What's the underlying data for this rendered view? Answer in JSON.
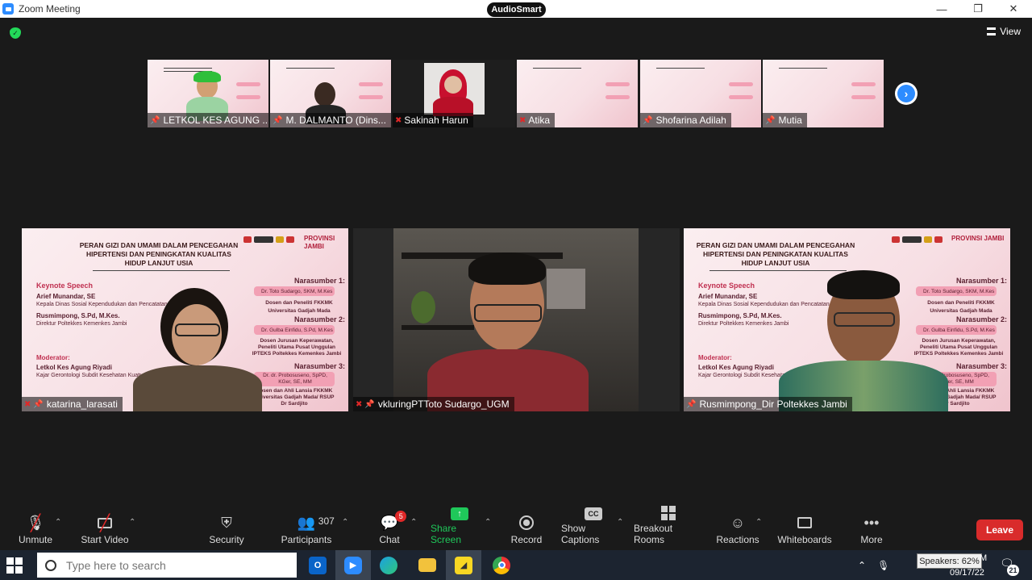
{
  "window": {
    "title": "Zoom Meeting",
    "badge": "AudioSmart",
    "minimize": "—",
    "restore": "❐",
    "close": "✕"
  },
  "header": {
    "view_label": "View"
  },
  "slide": {
    "title_line1": "PERAN GIZI DAN UMAMI DALAM PENCEGAHAN",
    "title_line2": "HIPERTENSI DAN PENINGKATAN KUALITAS",
    "title_line3": "HIDUP LANJUT USIA",
    "keynote": "Keynote Speech",
    "k1_name": "Arief Munandar, SE",
    "k1_role": "Kepala Dinas Sosial Kependudukan dan Pencatatan Sipil",
    "k2_name": "Rusmimpong, S.Pd, M.Kes.",
    "k2_role": "Direktur Poltekkes Kemenkes Jambi",
    "moderator": "Moderator:",
    "m_name": "Letkol Kes Agung Riyadi",
    "m_role": "Kajar Gerontologi Subdit Kesehatan Kuatman RI",
    "n1": "Narasumber 1:",
    "n1_name": "Dr. Toto Sudargo, SKM, M.Kes",
    "n1_role": "Dosen dan Peneliti FKKMK Universitas Gadjah Mada",
    "n2": "Narasumber 2:",
    "n2_name": "Dr. Gulba Einfidu, S.Pd, M.Kes",
    "n2_role": "Dosen Jurusan Keperawatan, Peneliti Utama Pusat Unggulan IPTEKS Poltekkes Kemenkes Jambi",
    "n3": "Narasumber 3:",
    "n3_name": "Dr. dr. Probosuseno, SpPD, KGer, SE, MM",
    "n3_role": "Dosen dan Ahli Lansia FKKMK Universitas Gadjah Mada/ RSUP Dr Sardjito",
    "brand": "PROVINSI JAMBI"
  },
  "gallery_top": [
    {
      "name": "LETKOL KES AGUNG ...",
      "muted": false,
      "pinned": true
    },
    {
      "name": "M. DALMANTO (Dins...",
      "muted": false,
      "pinned": true
    },
    {
      "name": "Sakinah Harun",
      "muted": true,
      "pinned": false
    },
    {
      "name": "Atika",
      "muted": true,
      "pinned": false
    },
    {
      "name": "Shofarina Adilah",
      "muted": false,
      "pinned": true
    },
    {
      "name": "Mutia",
      "muted": false,
      "pinned": true
    }
  ],
  "gallery_main": [
    {
      "name": "katarina_larasati",
      "muted": true,
      "pinned": true
    },
    {
      "name": "vkluringPTToto Sudargo_UGM",
      "muted": true,
      "pinned": true
    },
    {
      "name": "Rusmimpong_Dir Poltekkes Jambi",
      "muted": false,
      "pinned": true
    }
  ],
  "toolbar": {
    "unmute": "Unmute",
    "start_video": "Start Video",
    "security": "Security",
    "participants": "Participants",
    "participants_count": "307",
    "chat": "Chat",
    "chat_badge": "5",
    "share_screen": "Share Screen",
    "record": "Record",
    "show_captions": "Show Captions",
    "breakout_rooms": "Breakout Rooms",
    "reactions": "Reactions",
    "whiteboards": "Whiteboards",
    "more": "More",
    "leave": "Leave",
    "cc": "CC"
  },
  "taskbar": {
    "search_placeholder": "Type here to search",
    "tooltip": "Speakers: 62%",
    "date": "09/17/22",
    "time_fragment": "M",
    "notif_count": "21"
  },
  "colors": {
    "leave": "#d92b2b",
    "share": "#1fc85a",
    "accent": "#2d8cff",
    "muted": "#e02828"
  }
}
